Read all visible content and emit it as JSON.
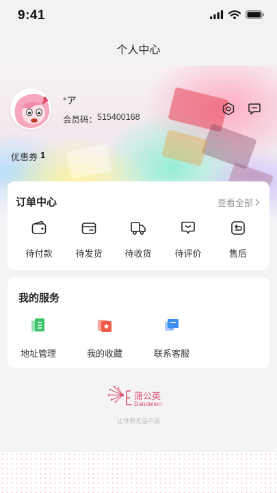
{
  "status_bar": {
    "time": "9:41"
  },
  "header": {
    "title": "个人中心"
  },
  "profile": {
    "name": "°ア",
    "member_label": "会员码：",
    "member_code": "515400168",
    "coupon_label": "优惠券",
    "coupon_count": "1"
  },
  "orders": {
    "title": "订单中心",
    "view_all": "查看全部",
    "items": [
      {
        "label": "待付款",
        "icon": "wallet-icon"
      },
      {
        "label": "待发货",
        "icon": "card-icon"
      },
      {
        "label": "待收货",
        "icon": "truck-icon"
      },
      {
        "label": "待评价",
        "icon": "review-icon"
      },
      {
        "label": "售后",
        "icon": "return-icon"
      }
    ]
  },
  "services": {
    "title": "我的服务",
    "items": [
      {
        "label": "地址管理",
        "icon": "address-icon"
      },
      {
        "label": "我的收藏",
        "icon": "favorites-icon"
      },
      {
        "label": "联系客服",
        "icon": "customer-service-icon"
      }
    ]
  },
  "footer": {
    "brand_cn": "蒲公英",
    "brand_en": "Dandelion",
    "tagline": "让世界无话不谈"
  },
  "colors": {
    "accent": "#d9506a",
    "icon_stroke": "#222222",
    "service_green": "#3cc46a",
    "service_red": "#f05a4a",
    "service_blue": "#3d8ef0"
  }
}
